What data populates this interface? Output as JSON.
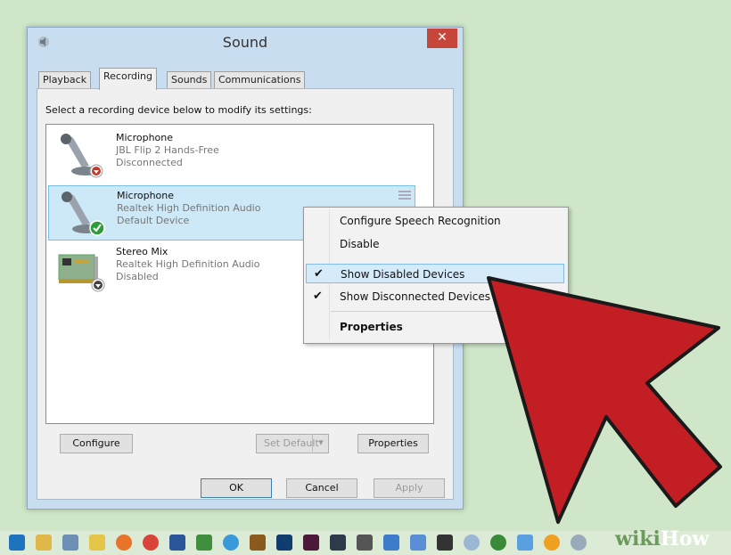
{
  "window": {
    "title": "Sound",
    "close_label": "✕"
  },
  "tabs": [
    {
      "label": "Playback"
    },
    {
      "label": "Recording"
    },
    {
      "label": "Sounds"
    },
    {
      "label": "Communications"
    }
  ],
  "instruction": "Select a recording device below to modify its settings:",
  "devices": [
    {
      "name": "Microphone",
      "sub": "JBL Flip 2 Hands-Free",
      "status": "Disconnected",
      "icon": "microphone-icon"
    },
    {
      "name": "Microphone",
      "sub": "Realtek High Definition Audio",
      "status": "Default Device",
      "icon": "microphone-icon"
    },
    {
      "name": "Stereo Mix",
      "sub": "Realtek High Definition Audio",
      "status": "Disabled",
      "icon": "sound-card-icon"
    }
  ],
  "buttons": {
    "configure": "Configure",
    "set_default": "Set Default",
    "properties": "Properties",
    "ok": "OK",
    "cancel": "Cancel",
    "apply": "Apply"
  },
  "context_menu": [
    {
      "label": "Configure Speech Recognition"
    },
    {
      "label": "Disable"
    },
    {
      "label": "Show Disabled Devices",
      "check": "✔"
    },
    {
      "label": "Show Disconnected Devices",
      "check": "✔"
    },
    {
      "label": "Properties"
    }
  ],
  "watermark": {
    "wiki": "wiki",
    "how": "How"
  },
  "colors": {
    "arrow": "#c41e25",
    "close": "#c7463a",
    "selection": "#cde8f7"
  }
}
